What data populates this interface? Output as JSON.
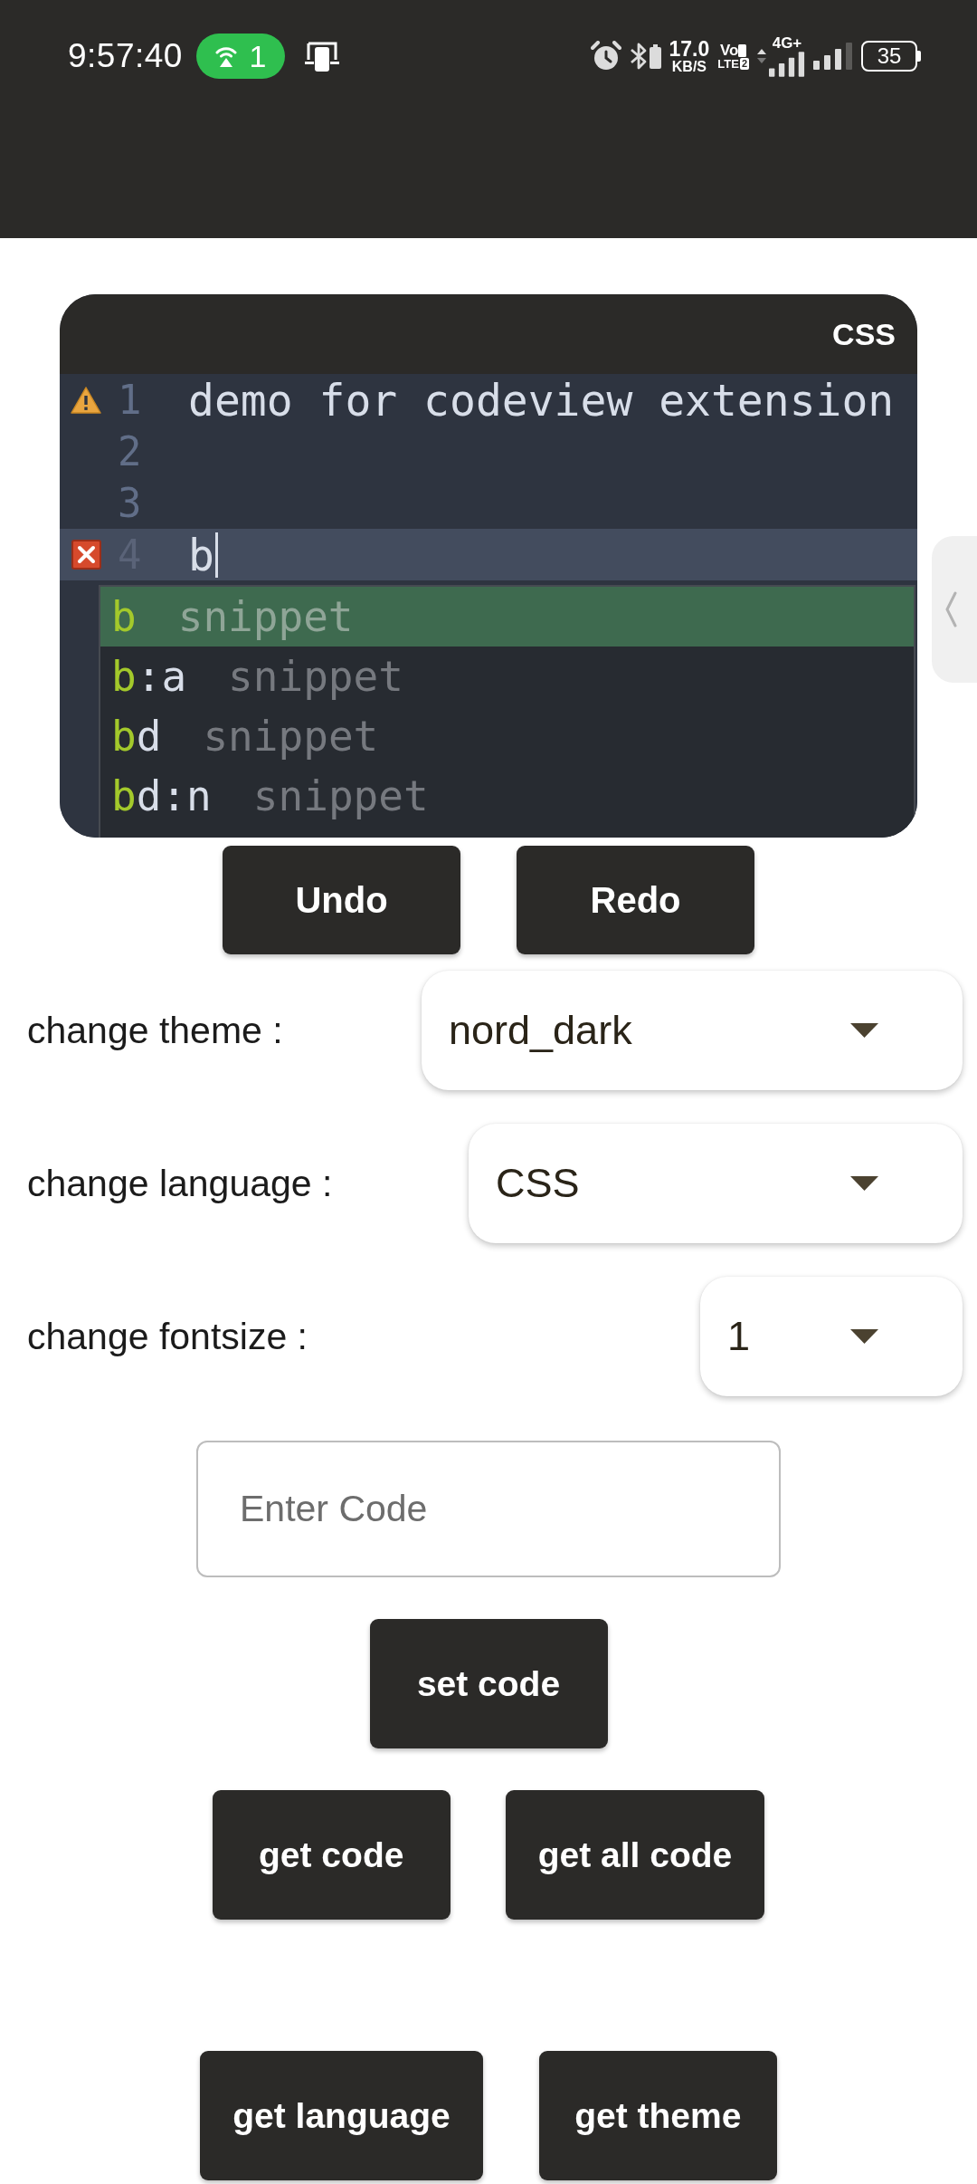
{
  "status_bar": {
    "time": "9:57:40",
    "hotspot_count": "1",
    "speed": "17.0",
    "speed_unit": "KB/S",
    "volte_top": "Vo",
    "volte_bottom": "LTE",
    "volte_sim": "2",
    "network_type": "4G+",
    "battery": "35"
  },
  "editor": {
    "language": "CSS",
    "lines": [
      {
        "number": "1",
        "text": "demo for codeview extension",
        "warning": true,
        "error": false,
        "active": false,
        "cursor": false
      },
      {
        "number": "2",
        "warning": false,
        "error": false,
        "active": false,
        "cursor": false
      },
      {
        "number": "3",
        "warning": false,
        "error": false,
        "active": false,
        "cursor": false
      },
      {
        "number": "4",
        "text": "b",
        "warning": false,
        "error": true,
        "active": true,
        "cursor": true
      }
    ],
    "autocomplete": [
      {
        "match": "b",
        "meta": "snippet",
        "selected": true
      },
      {
        "match": "b",
        "rest": ":a",
        "meta": "snippet",
        "selected": false
      },
      {
        "match": "b",
        "rest": "d",
        "meta": "snippet",
        "selected": false
      },
      {
        "match": "b",
        "rest": "d:n",
        "meta": "snippet",
        "selected": false
      }
    ]
  },
  "history_buttons": [
    "Undo",
    "Redo"
  ],
  "settings": [
    {
      "label": "change theme :",
      "value": "nord_dark"
    },
    {
      "label": "change language :",
      "value": "CSS"
    },
    {
      "label": "change fontsize :",
      "value": "1"
    }
  ],
  "code_input": {
    "placeholder": "Enter Code"
  },
  "action_rows": [
    [
      "set code"
    ],
    [
      "get code",
      "get all code"
    ],
    [
      "get language",
      "get theme"
    ]
  ]
}
